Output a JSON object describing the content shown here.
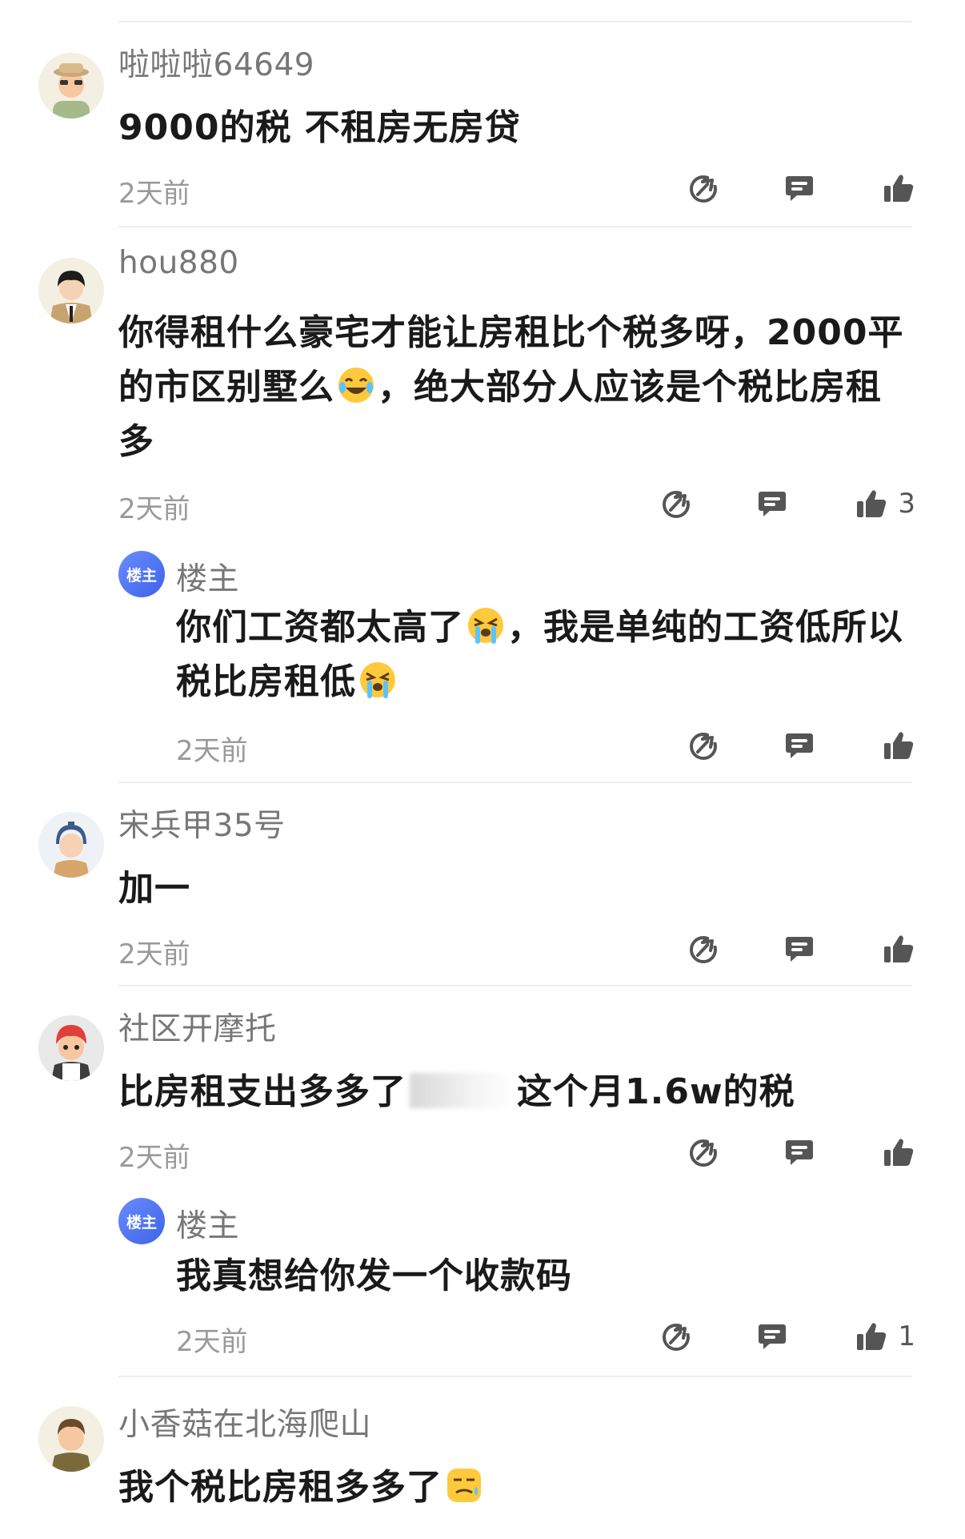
{
  "comments": [
    {
      "username": "啦啦啦64649",
      "text": "9000的税 不租房无房贷",
      "time": "2天前",
      "likes": ""
    },
    {
      "username": "hou880",
      "text_a": "你得租什么豪宅才能让房租比个税多呀，2000平的市区别墅么",
      "text_b": "，绝大部分人应该是个税比房租多",
      "time": "2天前",
      "likes": "3",
      "reply": {
        "badge": "楼主",
        "username": "楼主",
        "text_a": "你们工资都太高了",
        "text_b": "，我是单纯的工资低所以税比房租低",
        "time": "2天前",
        "likes": ""
      }
    },
    {
      "username": "宋兵甲35号",
      "text": "加一",
      "time": "2天前",
      "likes": ""
    },
    {
      "username": "社区开摩托",
      "text_a": "比房租支出多多了",
      "text_b": "这个月1.6w的税",
      "time": "2天前",
      "likes": "",
      "reply": {
        "badge": "楼主",
        "username": "楼主",
        "text": "我真想给你发一个收款码",
        "time": "2天前",
        "likes": "1"
      }
    },
    {
      "username": "小香菇在北海爬山",
      "text": "我个税比房租多多了",
      "time": "",
      "likes": ""
    }
  ],
  "icons": {
    "share": "share-icon",
    "reply": "comment-icon",
    "like": "thumbs-up-icon"
  },
  "colors": {
    "username": "#777777",
    "text": "#1a1a1a",
    "time": "#9a9a9a",
    "badge": "#4a6ef0"
  }
}
